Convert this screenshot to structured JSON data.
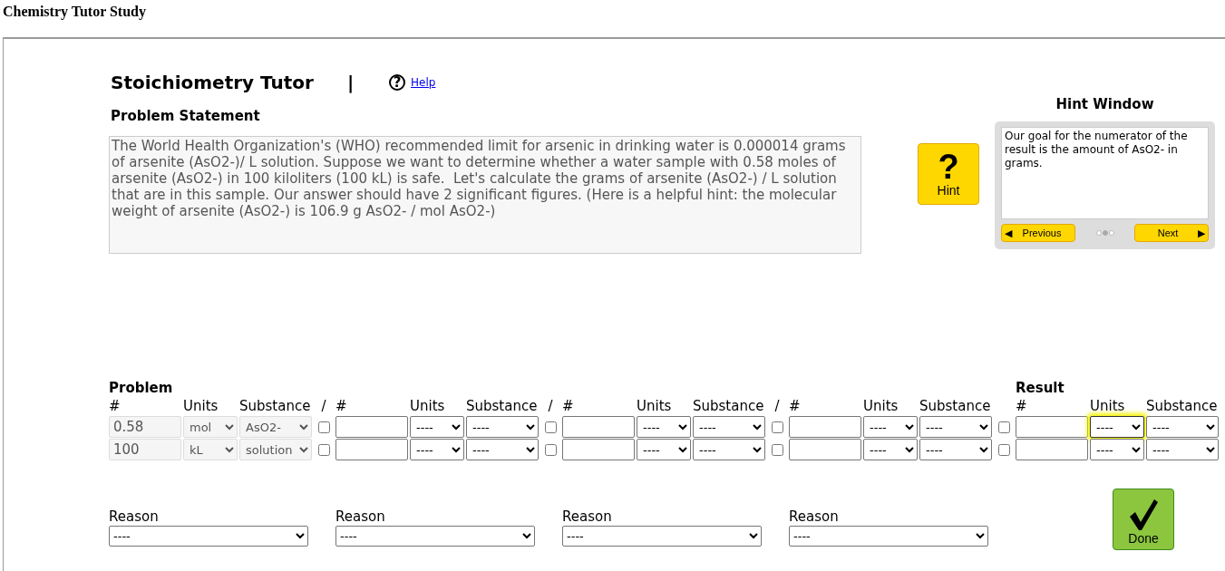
{
  "page_title": "Chemistry Tutor Study",
  "tutor": {
    "title": "Stoichiometry Tutor",
    "separator": "|",
    "help_symbol": "?",
    "help_link": "Help"
  },
  "problem_statement": {
    "heading": "Problem Statement",
    "text": "The World Health Organization's (WHO) recommended limit for arsenic in drinking water is 0.000014 grams of arsenite (AsO2-)/ L solution. Suppose we want to determine whether a water sample with 0.58 moles of arsenite (AsO2-) in 100 kiloliters (100 kL) is safe.  Let's calculate the grams of arsenite (AsO2-) / L solution that are in this sample. Our answer should have 2 significant figures. (Here is a helpful hint: the molecular weight of arsenite (AsO2-) is 106.9 g AsO2- / mol AsO2-)"
  },
  "hint_button": {
    "symbol": "?",
    "label": "Hint"
  },
  "hint_window": {
    "title": "Hint Window",
    "text": "Our goal for the numerator of the result is the amount of AsO2- in grams.",
    "previous_arrow": "◀",
    "previous": "Previous",
    "next": "Next",
    "next_arrow": "▶",
    "pages": [
      {
        "selected": false
      },
      {
        "selected": true
      },
      {
        "selected": false
      }
    ]
  },
  "workspace": {
    "problem_label": "Problem",
    "result_label": "Result",
    "groups": [
      {
        "kind": "term",
        "headers": [
          "#",
          "Units",
          "Substance"
        ],
        "divider": "/",
        "rows": [
          {
            "number": "0.58",
            "units": "mol",
            "substance": "AsO2-",
            "disabled": true,
            "checked": false,
            "highlighted": false
          },
          {
            "number": "100",
            "units": "kL",
            "substance": "solution",
            "disabled": true,
            "checked": false,
            "highlighted": false
          }
        ]
      },
      {
        "kind": "term",
        "headers": [
          "#",
          "Units",
          "Substance"
        ],
        "divider": "/",
        "rows": [
          {
            "units": "----",
            "substance": "----",
            "disabled": false,
            "checked": false,
            "highlighted": false
          },
          {
            "units": "----",
            "substance": "----",
            "disabled": false,
            "checked": false,
            "highlighted": false
          }
        ]
      },
      {
        "kind": "term",
        "headers": [
          "#",
          "Units",
          "Substance"
        ],
        "divider": "/",
        "rows": [
          {
            "units": "----",
            "substance": "----",
            "disabled": false,
            "checked": false,
            "highlighted": false
          },
          {
            "units": "----",
            "substance": "----",
            "disabled": false,
            "checked": false,
            "highlighted": false
          }
        ]
      },
      {
        "kind": "term",
        "headers": [
          "#",
          "Units",
          "Substance"
        ],
        "rows": [
          {
            "units": "----",
            "substance": "----",
            "disabled": false,
            "checked": false,
            "highlighted": false
          },
          {
            "units": "----",
            "substance": "----",
            "disabled": false,
            "checked": false,
            "highlighted": false
          }
        ]
      },
      {
        "kind": "result",
        "headers": [
          "#",
          "Units",
          "Substance"
        ],
        "rows": [
          {
            "units": "----",
            "substance": "----",
            "disabled": false,
            "highlighted": true
          },
          {
            "units": "----",
            "substance": "----",
            "disabled": false,
            "highlighted": false
          }
        ]
      }
    ]
  },
  "reasons": [
    {
      "label": "Reason",
      "value": "----"
    },
    {
      "label": "Reason",
      "value": "----"
    },
    {
      "label": "Reason",
      "value": "----"
    },
    {
      "label": "Reason",
      "value": "----"
    }
  ],
  "done_button": {
    "label": "Done"
  }
}
